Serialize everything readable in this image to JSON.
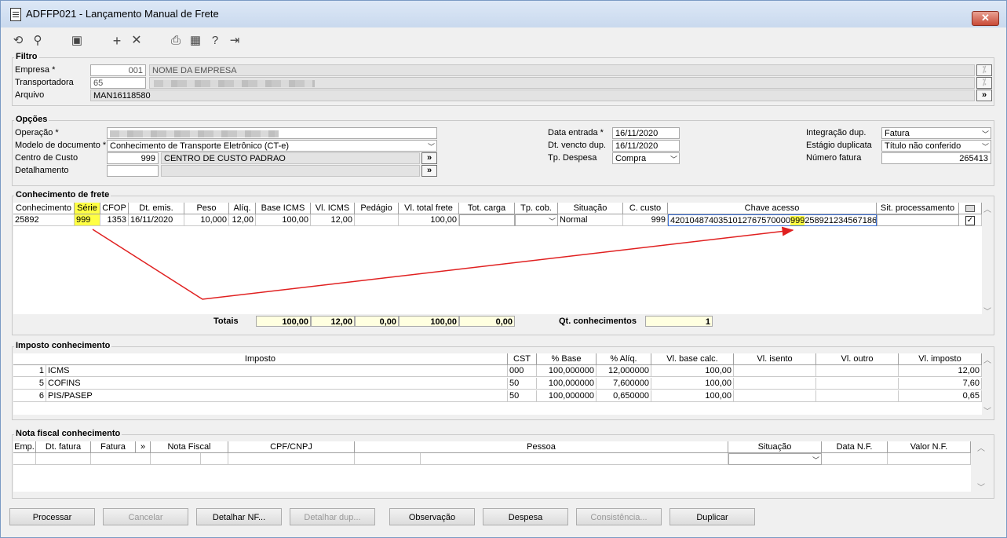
{
  "window": {
    "title": "ADFFP021 - Lançamento Manual de Frete",
    "close_label": "✕"
  },
  "toolbar": {
    "icons": [
      "undo-icon",
      "search-icon",
      "save-icon",
      "add-icon",
      "delete-icon",
      "print-icon",
      "calendar-icon",
      "help-icon",
      "exit-icon"
    ]
  },
  "filtro": {
    "title": "Filtro",
    "empresa_label": "Empresa *",
    "empresa_code": "001",
    "empresa_name": "NOME DA EMPRESA",
    "transportadora_label": "Transportadora",
    "transportadora_code": "65",
    "arquivo_label": "Arquivo",
    "arquivo_value": "MAN16118580",
    "more": "»"
  },
  "opcoes": {
    "title": "Opções",
    "operacao_label": "Operação *",
    "modelo_label": "Modelo de documento *",
    "modelo_value": "Conhecimento de Transporte Eletrônico (CT-e)",
    "centro_label": "Centro de Custo",
    "centro_code": "999",
    "centro_name": "CENTRO DE CUSTO PADRAO",
    "detalhamento_label": "Detalhamento",
    "data_entrada_label": "Data entrada *",
    "data_entrada": "16/11/2020",
    "dt_vencto_label": "Dt. vencto dup.",
    "dt_vencto": "16/11/2020",
    "tp_despesa_label": "Tp. Despesa",
    "tp_despesa": "Compra",
    "integracao_label": "Integração dup.",
    "integracao": "Fatura",
    "estagio_label": "Estágio duplicata",
    "estagio": "Título não conferido",
    "numero_fatura_label": "Número fatura",
    "numero_fatura": "265413"
  },
  "conhecimento": {
    "title": "Conhecimento de frete",
    "headers": [
      "Conhecimento",
      "Série",
      "CFOP",
      "Dt. emis.",
      "Peso",
      "Alíq.",
      "Base ICMS",
      "Vl. ICMS",
      "Pedágio",
      "Vl. total frete",
      "Tot. carga",
      "Tp. cob.",
      "Situação",
      "C. custo",
      "Chave acesso",
      "Sit. processamento"
    ],
    "row": {
      "conhecimento": "25892",
      "serie": "999",
      "cfop": "1353",
      "dt_emis": "16/11/2020",
      "peso": "10,000",
      "aliq": "12,00",
      "base_icms": "100,00",
      "vl_icms": "12,00",
      "vl_total": "100,00",
      "situacao": "Normal",
      "c_custo": "999",
      "chave_pre": "4201048740351012767570000",
      "chave_hl": "999",
      "chave_post": "258921234567186"
    },
    "totais_label": "Totais",
    "totais": [
      "100,00",
      "12,00",
      "0,00",
      "100,00",
      "0,00"
    ],
    "qt_label": "Qt. conhecimentos",
    "qt_value": "1"
  },
  "imposto": {
    "title": "Imposto conhecimento",
    "headers": [
      "Imposto",
      "CST",
      "% Base",
      "% Alíq.",
      "Vl. base calc.",
      "Vl. isento",
      "Vl. outro",
      "Vl. imposto"
    ],
    "rows": [
      {
        "n": "1",
        "imposto": "ICMS",
        "cst": "000",
        "base": "100,000000",
        "aliq": "12,000000",
        "vbase": "100,00",
        "vimposto": "12,00"
      },
      {
        "n": "5",
        "imposto": "COFINS",
        "cst": "50",
        "base": "100,000000",
        "aliq": "7,600000",
        "vbase": "100,00",
        "vimposto": "7,60"
      },
      {
        "n": "6",
        "imposto": "PIS/PASEP",
        "cst": "50",
        "base": "100,000000",
        "aliq": "0,650000",
        "vbase": "100,00",
        "vimposto": "0,65"
      }
    ]
  },
  "nota": {
    "title": "Nota fiscal conhecimento",
    "headers": [
      "Emp.",
      "Dt. fatura",
      "Fatura",
      "»",
      "Nota Fiscal",
      "CPF/CNPJ",
      "Pessoa",
      "Situação",
      "Data N.F.",
      "Valor N.F."
    ]
  },
  "buttons": [
    {
      "label": "Processar",
      "disabled": false
    },
    {
      "label": "Cancelar",
      "disabled": true
    },
    {
      "label": "Detalhar NF...",
      "disabled": false
    },
    {
      "label": "Detalhar dup...",
      "disabled": true
    },
    {
      "label": "Observação",
      "disabled": false
    },
    {
      "label": "Despesa",
      "disabled": false
    },
    {
      "label": "Consistência...",
      "disabled": true
    },
    {
      "label": "Duplicar",
      "disabled": false
    }
  ],
  "colors": {
    "highlight": "#ffff44",
    "arrow": "#e02020",
    "totals_bg": "#ffffe0"
  }
}
